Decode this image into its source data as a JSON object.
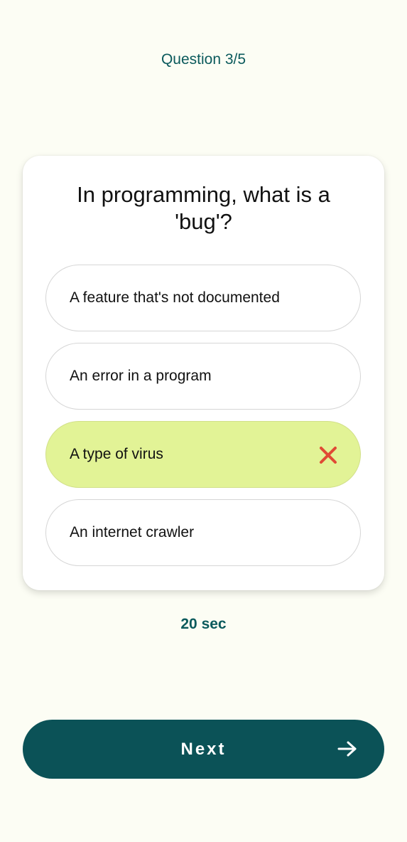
{
  "header": {
    "progress_text": "Question 3/5"
  },
  "quiz": {
    "question": "In programming, what is a 'bug'?",
    "options": [
      {
        "label": "A feature that's not documented",
        "state": "default"
      },
      {
        "label": "An error in a program",
        "state": "default"
      },
      {
        "label": "A type of virus",
        "state": "selected-wrong",
        "icon": "wrong-x-icon"
      },
      {
        "label": "An internet crawler",
        "state": "default"
      }
    ]
  },
  "timer": {
    "text": "20 sec"
  },
  "footer": {
    "next_label": "Next",
    "next_icon": "arrow-right-icon"
  },
  "colors": {
    "background": "#fcfdf4",
    "accent": "#0b5257",
    "selected_option": "#e2f396",
    "wrong_mark": "#e04a35"
  }
}
